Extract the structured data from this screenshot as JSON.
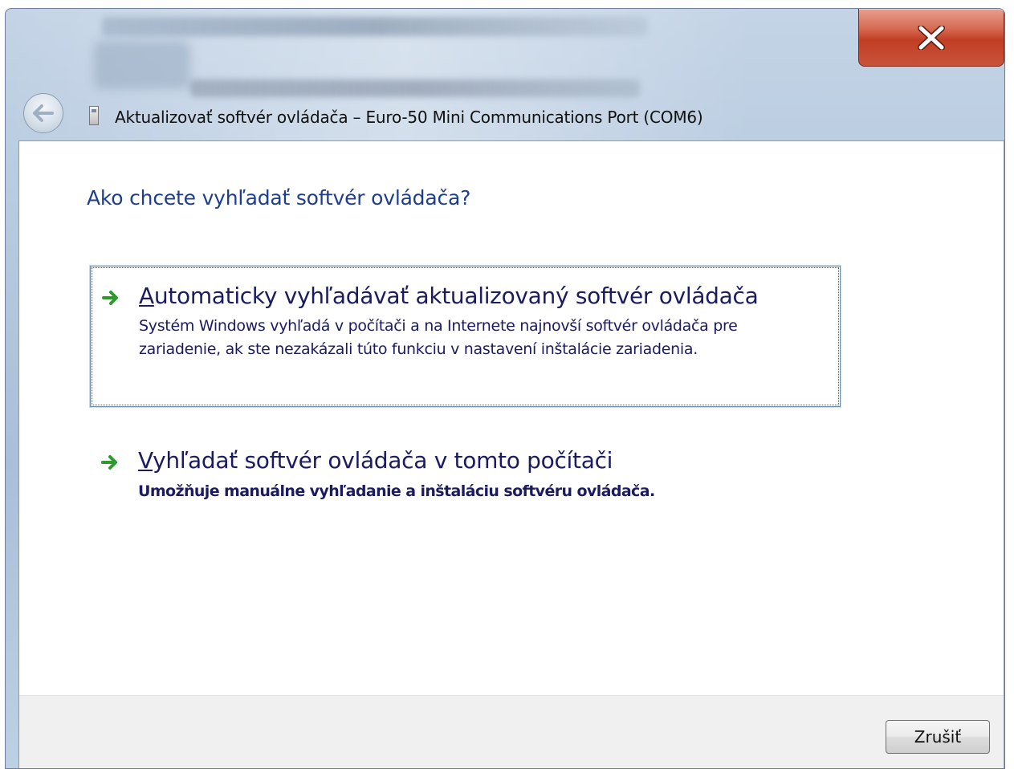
{
  "window": {
    "title": "Aktualizovať softvér ovládača – Euro-50 Mini Communications Port (COM6)"
  },
  "main": {
    "heading": "Ako chcete vyhľadať softvér ovládača?",
    "options": [
      {
        "title_access_key": "A",
        "title_rest": "utomaticky vyhľadávať aktualizovaný softvér ovládača",
        "description_line1": "Systém Windows vyhľadá v počítači a na Internete najnovší softvér ovládača pre",
        "description_line2": "zariadenie, ak ste nezakázali túto funkciu v nastavení inštalácie zariadenia."
      },
      {
        "title_access_key": "V",
        "title_rest": "yhľadať softvér ovládača v tomto počítači",
        "description_line1": "Umožňuje manuálne vyhľadanie a inštaláciu softvéru ovládača."
      }
    ]
  },
  "footer": {
    "cancel_label": "Zrušiť"
  },
  "icons": {
    "close": "close-icon",
    "back": "back-arrow-icon",
    "option_arrow": "green-arrow-icon",
    "title": "device-port-icon"
  },
  "colors": {
    "heading": "#1d3d8f",
    "option_text": "#1b1b60",
    "arrow_green": "#2e9a2e",
    "close_red": "#c13e24"
  }
}
